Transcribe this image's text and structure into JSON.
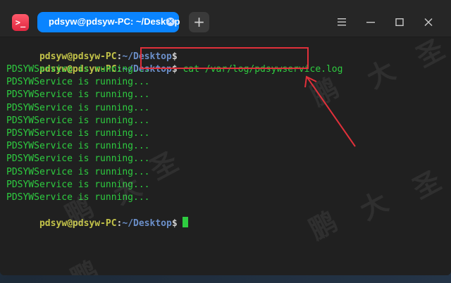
{
  "app": {
    "icon": "terminal-icon",
    "icon_glyph": ">_"
  },
  "tabs": [
    {
      "label": "pdsyw@pdsyw-PC: ~/Desktop",
      "active": true
    }
  ],
  "tab_close_glyph": "×",
  "add_tab_glyph": "+",
  "window_controls": {
    "menu": "menu-icon",
    "minimize": "minimize-icon",
    "maximize": "maximize-icon",
    "close": "close-icon"
  },
  "prompt": {
    "user_host": "pdsyw@pdsyw-PC",
    "colon": ":",
    "path": "~/Desktop",
    "dollar": "$"
  },
  "terminal": {
    "command": " cat /var/log/pdsywservice.log",
    "output": [
      "PDSYWService is running...",
      "PDSYWService is running...",
      "PDSYWService is running...",
      "PDSYWService is running...",
      "PDSYWService is running...",
      "PDSYWService is running...",
      "PDSYWService is running...",
      "PDSYWService is running...",
      "PDSYWService is running...",
      "PDSYWService is running...",
      "PDSYWService is running..."
    ]
  },
  "watermark": [
    "鹏",
    "大",
    "圣"
  ],
  "colors": {
    "accent_tab": "#0a84ff",
    "prompt_user": "#c3c349",
    "prompt_path": "#6b8fc9",
    "output_text": "#2ecc40",
    "annotation": "#e0303a"
  }
}
